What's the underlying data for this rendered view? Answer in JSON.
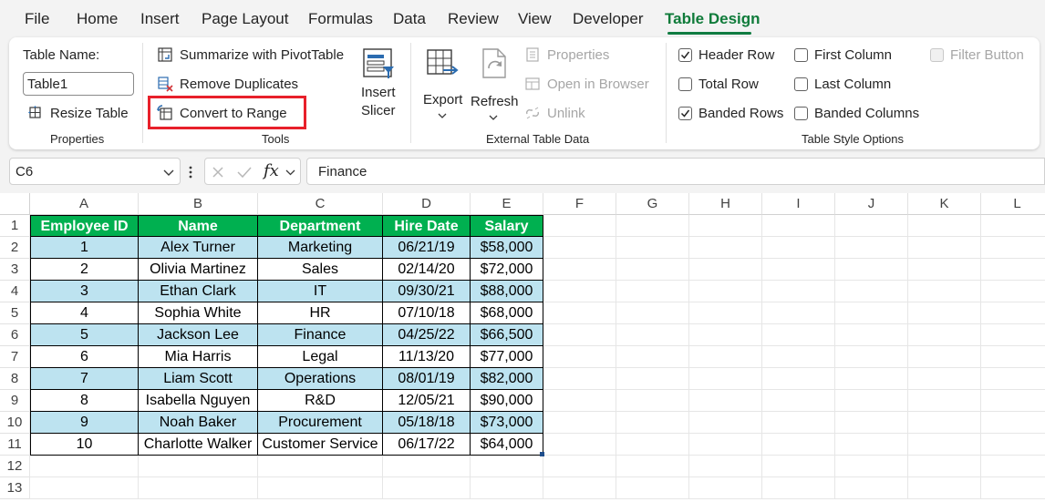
{
  "menu_tabs": [
    "File",
    "Home",
    "Insert",
    "Page Layout",
    "Formulas",
    "Data",
    "Review",
    "View",
    "Developer",
    "Table Design"
  ],
  "active_tab": "Table Design",
  "ribbon": {
    "properties": {
      "table_name_label": "Table Name:",
      "table_name_value": "Table1",
      "resize_table": "Resize Table",
      "group_label": "Properties"
    },
    "tools": {
      "summarize_pivot": "Summarize with PivotTable",
      "remove_duplicates": "Remove Duplicates",
      "convert_to_range": "Convert to Range",
      "insert_slicer_line1": "Insert",
      "insert_slicer_line2": "Slicer",
      "group_label": "Tools"
    },
    "external": {
      "export": "Export",
      "refresh": "Refresh",
      "properties": "Properties",
      "open_in_browser": "Open in Browser",
      "unlink": "Unlink",
      "group_label": "External Table Data"
    },
    "style_options": {
      "header_row": {
        "label": "Header Row",
        "checked": true
      },
      "total_row": {
        "label": "Total Row",
        "checked": false
      },
      "banded_rows": {
        "label": "Banded Rows",
        "checked": true
      },
      "first_column": {
        "label": "First Column",
        "checked": false
      },
      "last_column": {
        "label": "Last Column",
        "checked": false
      },
      "banded_columns": {
        "label": "Banded Columns",
        "checked": false
      },
      "filter_button": {
        "label": "Filter Button",
        "checked": false
      },
      "group_label": "Table Style Options"
    }
  },
  "formula_bar": {
    "cell_ref": "C6",
    "fx_label": "fx",
    "formula": "Finance"
  },
  "grid": {
    "column_letters": [
      "A",
      "B",
      "C",
      "D",
      "E",
      "F",
      "G",
      "H",
      "I",
      "J",
      "K",
      "L"
    ],
    "row_numbers": [
      "1",
      "2",
      "3",
      "4",
      "5",
      "6",
      "7",
      "8",
      "9",
      "10",
      "11",
      "12",
      "13"
    ]
  },
  "table": {
    "headers": [
      "Employee ID",
      "Name",
      "Department",
      "Hire Date",
      "Salary"
    ],
    "rows": [
      [
        "1",
        "Alex Turner",
        "Marketing",
        "06/21/19",
        "$58,000"
      ],
      [
        "2",
        "Olivia Martinez",
        "Sales",
        "02/14/20",
        "$72,000"
      ],
      [
        "3",
        "Ethan Clark",
        "IT",
        "09/30/21",
        "$88,000"
      ],
      [
        "4",
        "Sophia White",
        "HR",
        "07/10/18",
        "$68,000"
      ],
      [
        "5",
        "Jackson Lee",
        "Finance",
        "04/25/22",
        "$66,500"
      ],
      [
        "6",
        "Mia Harris",
        "Legal",
        "11/13/20",
        "$77,000"
      ],
      [
        "7",
        "Liam Scott",
        "Operations",
        "08/01/19",
        "$82,000"
      ],
      [
        "8",
        "Isabella Nguyen",
        "R&D",
        "12/05/21",
        "$90,000"
      ],
      [
        "9",
        "Noah Baker",
        "Procurement",
        "05/18/18",
        "$73,000"
      ],
      [
        "10",
        "Charlotte Walker",
        "Customer Service",
        "06/17/22",
        "$64,000"
      ]
    ]
  },
  "colors": {
    "accent": "#107c41",
    "table_header": "#00b050",
    "band": "#bde3f0",
    "highlight_box": "#e8202a"
  }
}
